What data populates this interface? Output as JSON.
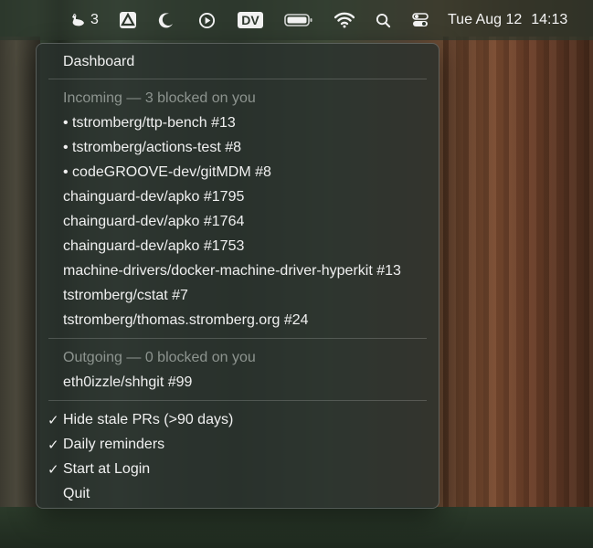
{
  "menubar": {
    "goose_icon": "goose-icon",
    "goose_count": "3",
    "dv_label": "DV",
    "date": "Tue Aug 12",
    "time": "14:13"
  },
  "menu": {
    "dashboard": "Dashboard",
    "incoming_header": "Incoming — 3 blocked on you",
    "incoming_items": [
      {
        "label": "• tstromberg/ttp-bench #13"
      },
      {
        "label": "• tstromberg/actions-test #8"
      },
      {
        "label": "• codeGROOVE-dev/gitMDM #8"
      },
      {
        "label": "chainguard-dev/apko #1795"
      },
      {
        "label": "chainguard-dev/apko #1764"
      },
      {
        "label": "chainguard-dev/apko #1753"
      },
      {
        "label": "machine-drivers/docker-machine-driver-hyperkit #13"
      },
      {
        "label": "tstromberg/cstat #7"
      },
      {
        "label": "tstromberg/thomas.stromberg.org #24"
      }
    ],
    "outgoing_header": "Outgoing — 0 blocked on you",
    "outgoing_items": [
      {
        "label": "eth0izzle/shhgit #99"
      }
    ],
    "settings": [
      {
        "check": "✓",
        "label": "Hide stale PRs (>90 days)"
      },
      {
        "check": "✓",
        "label": "Daily reminders"
      },
      {
        "check": "✓",
        "label": "Start at Login"
      }
    ],
    "quit": "Quit"
  }
}
